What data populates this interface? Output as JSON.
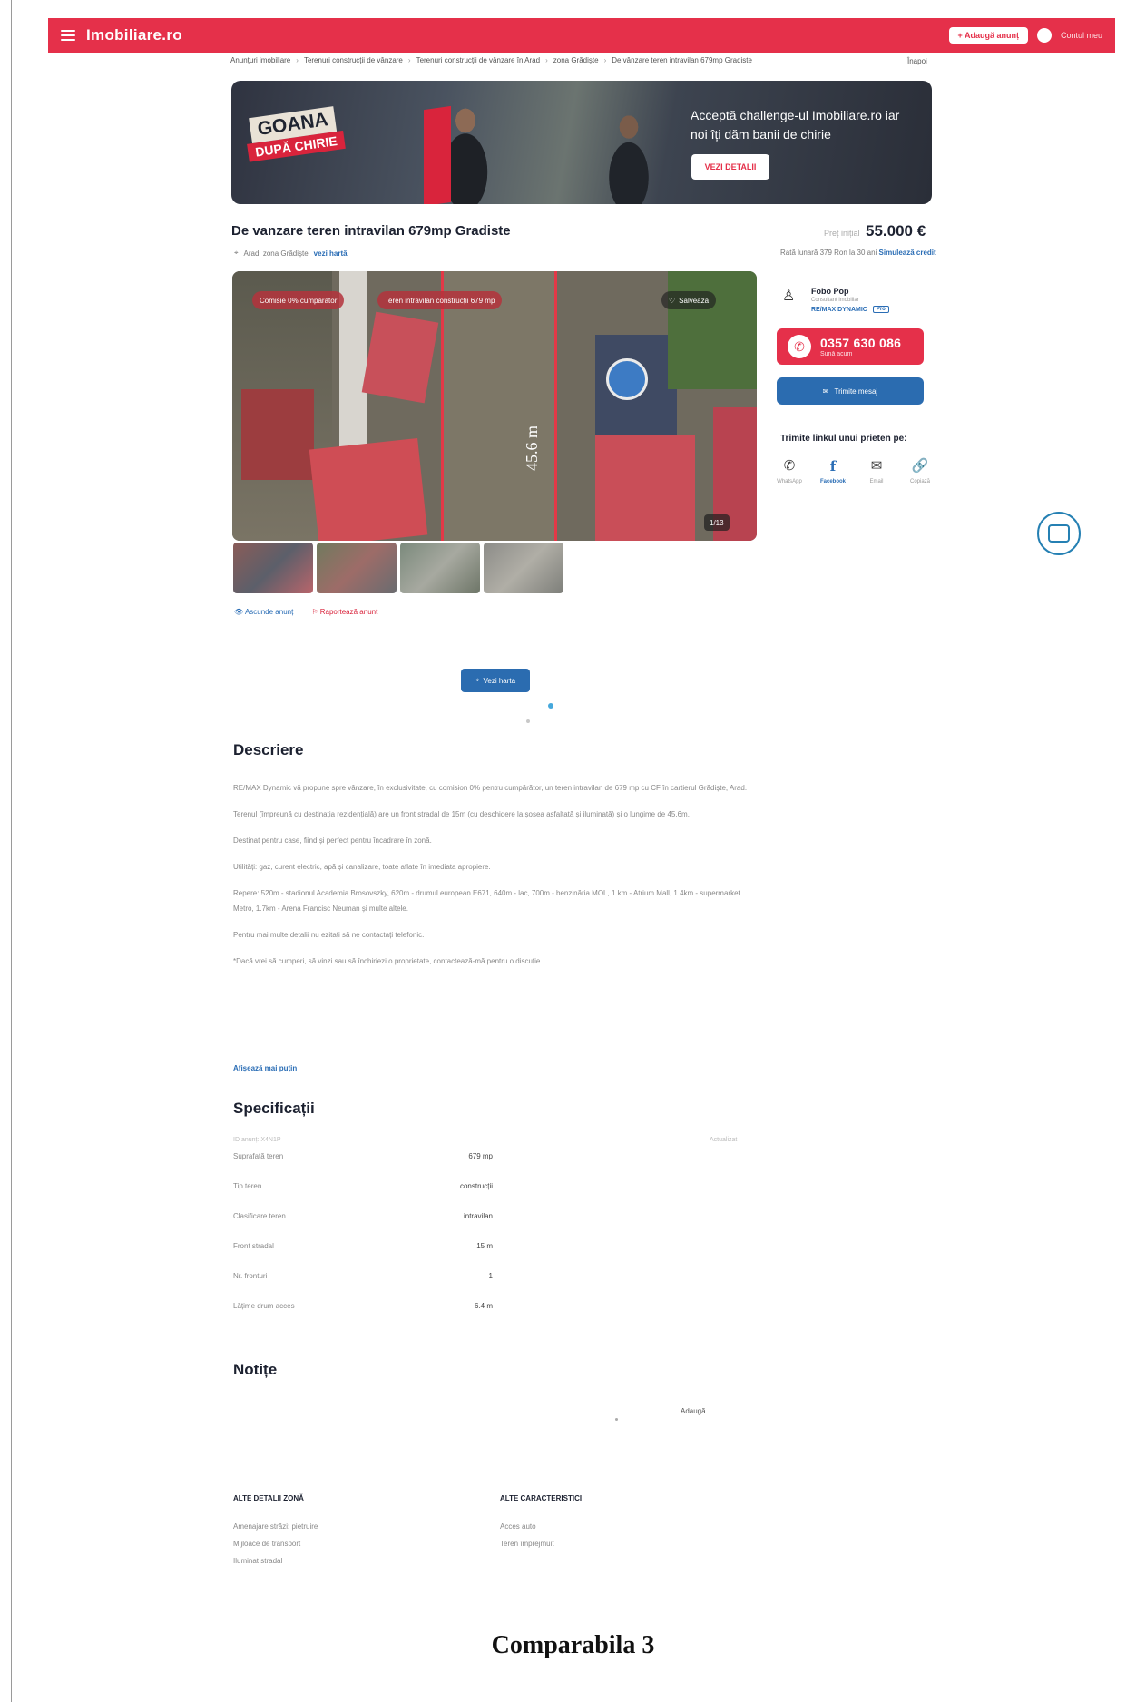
{
  "header": {
    "logo": "Imobiliare.ro",
    "add_button": "+ Adaugă anunț",
    "account_label": "Contul meu"
  },
  "breadcrumb": {
    "items": [
      "Anunțuri imobiliare",
      "Terenuri construcții de vânzare",
      "Terenuri construcții de vânzare în Arad",
      "zona Grădiște",
      "De vânzare teren intravilan 679mp Gradiste"
    ],
    "back": "Înapoi"
  },
  "banner": {
    "badge_top": "GOANA",
    "badge_bottom": "DUPĂ CHIRIE",
    "text": "Acceptă challenge-ul Imobiliare.ro iar noi îți dăm banii de chirie",
    "button": "VEZI DETALII"
  },
  "listing": {
    "title": "De vanzare teren intravilan 679mp Gradiste",
    "location": "Arad, zona Grădiște",
    "map_link": "vezi hartă",
    "price_old": "Preț inițial",
    "price": "55.000 €",
    "credit_text": "Rată lunară 379 Ron la 30 ani",
    "credit_link": "Simulează credit"
  },
  "gallery": {
    "pill_1": "Comisie 0% cumpărător",
    "pill_2": "Teren intravilan construcții 679 mp",
    "save_label": "Salvează",
    "counter": "1/13",
    "measure": "45.6 m"
  },
  "actions": {
    "hide": "Ascunde anunț",
    "report": "Raportează anunț"
  },
  "map_button": "Vezi harta",
  "agent": {
    "name": "Fobo Pop",
    "subtitle": "Consultant imobiliar",
    "agency": "RE/MAX DYNAMIC",
    "agency_badge": "Pro",
    "phone": "0357 630 086",
    "phone_sub": "Sună acum",
    "message_button": "Trimite mesaj",
    "share_title": "Trimite linkul unui prieten pe:",
    "share": [
      {
        "label": "WhatsApp",
        "icon": "whatsapp-icon",
        "glyph": "✆"
      },
      {
        "label": "Facebook",
        "icon": "facebook-icon",
        "glyph": "f"
      },
      {
        "label": "Email",
        "icon": "email-icon",
        "glyph": "✉"
      },
      {
        "label": "Copiază",
        "icon": "link-icon",
        "glyph": "🔗"
      }
    ]
  },
  "description": {
    "title": "Descriere",
    "paragraphs": [
      "RE/MAX Dynamic vă propune spre vânzare, în exclusivitate, cu comision 0% pentru cumpărător, un teren intravilan de 679 mp cu CF în cartierul Grădiște, Arad.",
      "Terenul (împreună cu destinația rezidențială) are un front stradal de 15m (cu deschidere la șosea asfaltată și iluminată) și o lungime de 45.6m.",
      "Destinat pentru case, fiind și perfect pentru încadrare în zonă.",
      "Utilități: gaz, curent electric, apă și canalizare, toate aflate în imediata apropiere.",
      "Repere: 520m - stadionul Academia Brosovszky, 620m - drumul european E671, 640m - lac, 700m - benzinăria MOL, 1 km - Atrium Mall, 1.4km - supermarket Metro, 1.7km - Arena Francisc Neuman și multe altele.",
      "Pentru mai multe detalii nu ezitați să ne contactați telefonic.",
      "*Dacă vrei să cumperi, să vinzi sau să închiriezi o proprietate, contactează-mă pentru o discuție."
    ],
    "show_less": "Afișează mai puțin"
  },
  "specs": {
    "title": "Specificații",
    "header_left": "ID anunț: X4N1P",
    "header_right": "Actualizat",
    "rows": [
      {
        "k": "Suprafață teren",
        "v": "679 mp"
      },
      {
        "k": "Tip teren",
        "v": "construcții"
      },
      {
        "k": "Clasificare teren",
        "v": "intravilan"
      },
      {
        "k": "Front stradal",
        "v": "15 m"
      },
      {
        "k": "Nr. fronturi",
        "v": "1"
      },
      {
        "k": "Lățime drum acces",
        "v": "6.4 m"
      }
    ]
  },
  "notes": {
    "title": "Notițe",
    "add": "Adaugă"
  },
  "other_zone": {
    "title": "ALTE DETALII ZONĂ",
    "items": [
      "Amenajare străzi: pietruire",
      "Mijloace de transport",
      "Iluminat stradal"
    ]
  },
  "other_features": {
    "title": "ALTE CARACTERISTICI",
    "items": [
      "Acces auto",
      "Teren împrejmuit"
    ]
  },
  "caption": "Comparabila 3"
}
